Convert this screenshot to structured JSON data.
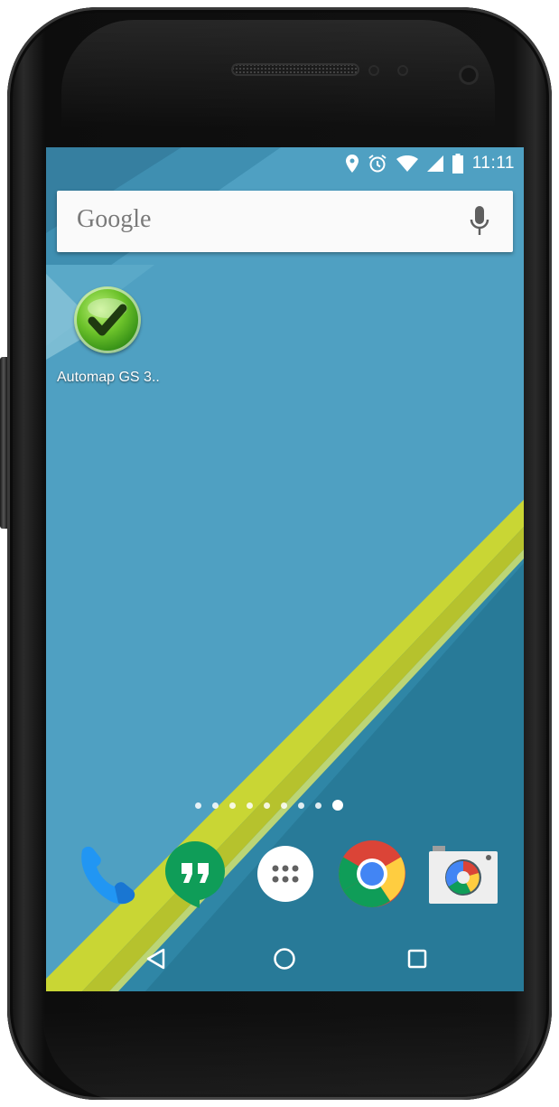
{
  "status_bar": {
    "time": "11:11",
    "icons": [
      "location-icon",
      "alarm-icon",
      "wifi-icon",
      "signal-icon",
      "battery-icon"
    ]
  },
  "search": {
    "logo_text": "Google",
    "icon": "mic-icon"
  },
  "desktop_apps": [
    {
      "label": "Automap GS 3..",
      "icon": "automap-check-icon"
    }
  ],
  "page_indicator": {
    "count": 9,
    "active_index": 8
  },
  "dock": [
    {
      "name": "phone",
      "icon": "phone-icon"
    },
    {
      "name": "hangouts",
      "icon": "hangouts-icon"
    },
    {
      "name": "all-apps",
      "icon": "app-drawer-icon"
    },
    {
      "name": "chrome",
      "icon": "chrome-icon"
    },
    {
      "name": "camera",
      "icon": "camera-icon"
    }
  ],
  "nav_bar": [
    "back-icon",
    "home-icon",
    "recents-icon"
  ],
  "colors": {
    "wallpaper_teal": "#4fa0c2",
    "wallpaper_dark": "#2b7e9c",
    "stripe_yellow": "#cddc39",
    "phone_blue": "#2196f3",
    "hangouts_green": "#0f9d58"
  }
}
